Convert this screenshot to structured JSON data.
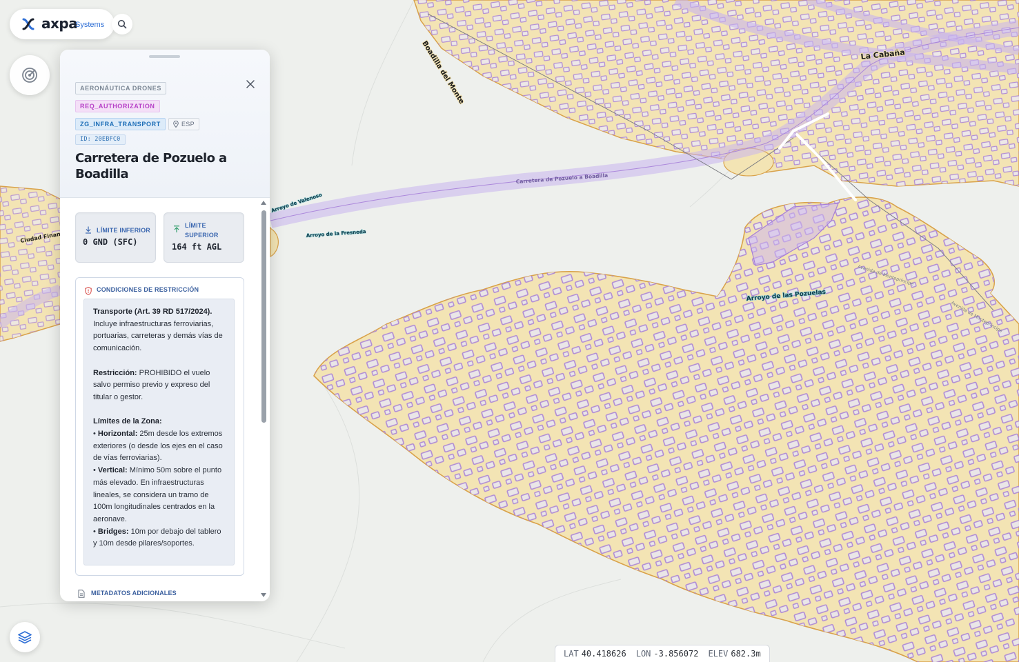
{
  "app": {
    "brand_name": "axpa",
    "brand_sub": "Systems",
    "accent": "#2f6fd6"
  },
  "icons": {
    "search": "search-icon",
    "radar": "radar-icon",
    "layers": "layers-icon",
    "close": "close-icon"
  },
  "map": {
    "zone_fill": "#f3e4b4",
    "zone_border": "#d9a24a",
    "building_outline": "#a67fd9",
    "road_color": "#b9a3e6",
    "labels": {
      "road_main": "Carretera de Pozuelo a Boadilla",
      "place_1": "La Cabaña",
      "place_2": "Boadilla del Monte",
      "stream_1": "Arroyo de las Pozuelas",
      "stream_2": "Arroyo de Valenoso",
      "stream_3": "Arroyo de la Fresneda",
      "place_left": "Ciudad Financiera",
      "road_right": "Avenida de Montepríncipe",
      "road_right2": "Avenida de Montepríncipe"
    }
  },
  "panel": {
    "category_tag": "AERONÁUTICA DRONES",
    "requirement_tag": "REQ_AUTHORIZATION",
    "zone_tag": "ZG_INFRA_TRANSPORT",
    "country_tag": "ESP",
    "id_tag": "ID: 20EBFC0",
    "title": "Carretera de Pozuelo a Boadilla",
    "lower_limit": {
      "label": "LÍMITE INFERIOR",
      "value": "0 GND (SFC)"
    },
    "upper_limit": {
      "label_line1": "LÍMITE",
      "label_line2": "SUPERIOR",
      "value": "164 ft AGL"
    },
    "conditions": {
      "heading": "CONDICIONES DE RESTRICCIÓN",
      "p1_bold": "Transporte (Art. 39 RD 517/2024).",
      "p1_text": "Incluye infraestructuras ferroviarias, portuarias, carreteras y demás vías de comunicación.",
      "p2_bold": "Restricción:",
      "p2_text": " PROHIBIDO el vuelo salvo permiso previo y expreso del titular o gestor.",
      "p3_bold": "Límites de la Zona:",
      "b1_bold": "Horizontal:",
      "b1_text": " 25m desde los extremos exteriores (o desde los ejes en el caso de vías ferroviarias).",
      "b2_bold": "Vertical:",
      "b2_text": " Mínimo 50m sobre el punto más elevado. En infraestructuras lineales, se considera un tramo de 100m longitudinales centrados en la aeronave.",
      "b3_bold": "Bridges:",
      "b3_text": " 10m por debajo del tablero y 10m desde pilares/soportes."
    },
    "metadata_label": "METADATOS ADICIONALES"
  },
  "coords": {
    "lat_label": "LAT",
    "lat_value": "40.418626",
    "lon_label": "LON",
    "lon_value": "-3.856072",
    "elev_label": "ELEV",
    "elev_value": "682.3m"
  }
}
